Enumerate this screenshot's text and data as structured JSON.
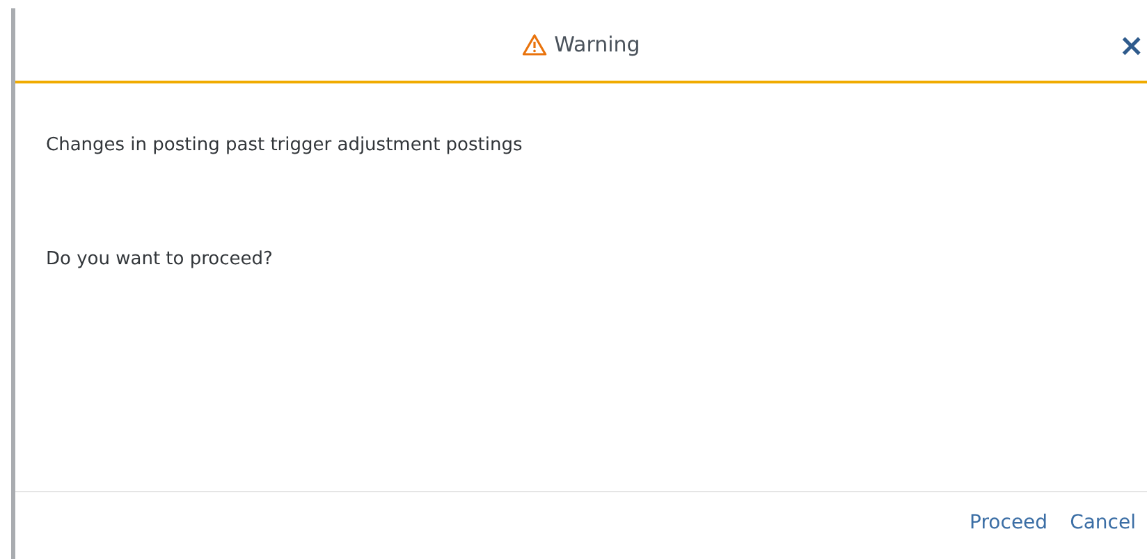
{
  "dialog": {
    "title": "Warning",
    "close": "×",
    "messages": [
      "Changes in posting past trigger adjustment postings",
      "Do you want to proceed?"
    ],
    "buttons": [
      "Proceed",
      "Cancel"
    ]
  }
}
